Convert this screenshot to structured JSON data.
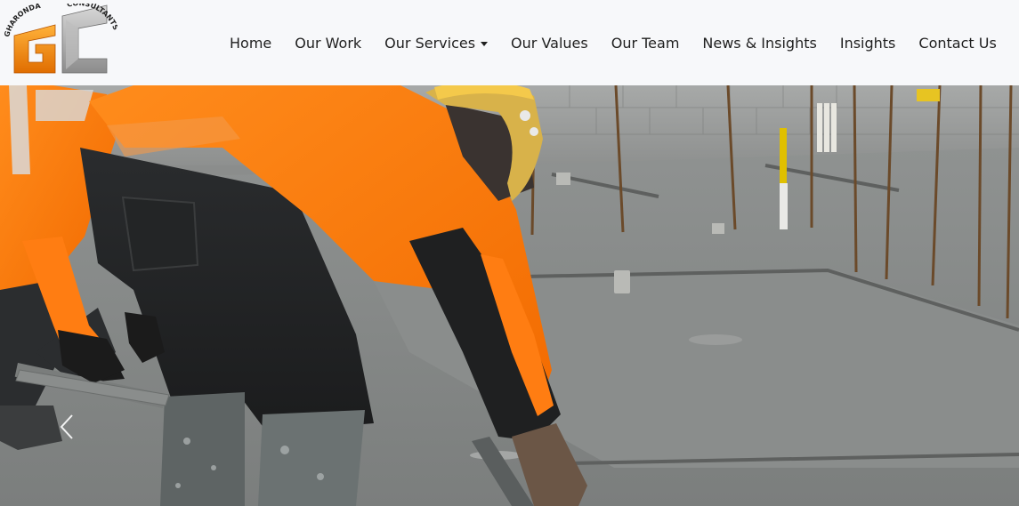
{
  "brand": {
    "arc_text_left": "GHARONDA",
    "arc_text_right": "CONSULTANTS",
    "monogram": "GC",
    "colors": {
      "orange": "#f08a12",
      "gray": "#9a9a9a",
      "dark": "#222222"
    }
  },
  "nav": {
    "items": [
      {
        "label": "Home"
      },
      {
        "label": "Our Work"
      },
      {
        "label": "Our Services",
        "has_dropdown": true
      },
      {
        "label": "Our Values"
      },
      {
        "label": "Our Team"
      },
      {
        "label": "News & Insights"
      },
      {
        "label": "Insights"
      },
      {
        "label": "Contact Us"
      }
    ]
  },
  "hero": {
    "image_subject": "construction-workers-screeding-concrete-slab",
    "prev_icon": "chevron-left-icon",
    "accent_color": "#ff7a12"
  }
}
